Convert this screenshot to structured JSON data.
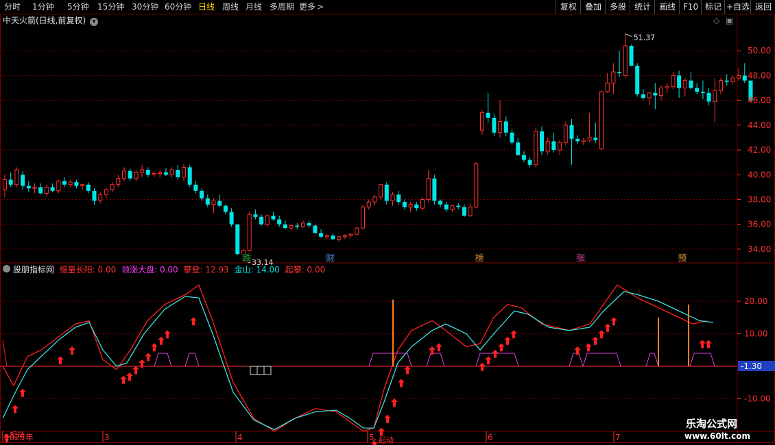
{
  "toolbar": {
    "periods": [
      "分时",
      "1分钟",
      "5分钟",
      "15分钟",
      "30分钟",
      "60分钟",
      "日线",
      "周线",
      "月线",
      "多周期",
      "更多"
    ],
    "active": "日线",
    "more_arrow": ">",
    "right_buttons": [
      "复权",
      "叠加",
      "多股",
      "统计",
      "画线",
      "F10",
      "+自选",
      "返回"
    ]
  },
  "main_panel": {
    "title": "中天火箭(日线,前复权)",
    "high_label": "51.37",
    "low_label": "33.14",
    "y_ticks": [
      "50.00",
      "48.00",
      "46.00",
      "44.00",
      "42.00",
      "40.00",
      "38.00",
      "36.00",
      "34.00"
    ],
    "markers": [
      {
        "text": "跌",
        "color": "#1aa01a"
      },
      {
        "text": "财",
        "color": "#3a7bd5"
      },
      {
        "text": "榜",
        "color": "#d68a1a"
      },
      {
        "text": "张",
        "color": "#d0308a"
      },
      {
        "text": "预",
        "color": "#d68a1a"
      }
    ]
  },
  "sub_panel": {
    "title": "股朋指标网",
    "items": [
      {
        "label": "缩量长阳:",
        "value": "0.00",
        "color": "#ff3030"
      },
      {
        "label": "领涨大盘:",
        "value": "0.00",
        "color": "#ff40ff"
      },
      {
        "label": "攀登:",
        "value": "12.93",
        "color": "#ff3030"
      },
      {
        "label": "金山:",
        "value": "14.00",
        "color": "#00e5e5"
      },
      {
        "label": "起攀:",
        "value": "0.00",
        "color": "#ff3030"
      }
    ],
    "y_ticks": [
      "20.00",
      "10.00",
      "-10.00"
    ],
    "current_value": "-1.30",
    "annotations": [
      "起动",
      "起动"
    ]
  },
  "x_axis": {
    "labels": [
      "2025年",
      "3",
      "4",
      "5",
      "6",
      "7"
    ]
  },
  "watermark": {
    "line1": "乐淘公式网",
    "line2": "www.60lt.com"
  },
  "colors": {
    "up": "#ff3030",
    "down": "#00e5e5",
    "grid": "#7a0000",
    "axis_text": "#ff3030"
  },
  "chart_data": {
    "type": "candlestick",
    "title": "中天火箭(日线,前复权)",
    "ylim": [
      33.0,
      52.0
    ],
    "ohlc": [
      [
        38.8,
        40.0,
        38.2,
        39.6
      ],
      [
        39.6,
        40.2,
        39.0,
        39.2
      ],
      [
        39.2,
        40.6,
        39.0,
        40.4
      ],
      [
        40.0,
        40.3,
        38.8,
        39.1
      ],
      [
        39.1,
        39.5,
        38.6,
        38.9
      ],
      [
        38.9,
        39.3,
        38.5,
        39.0
      ],
      [
        39.0,
        39.3,
        38.4,
        38.5
      ],
      [
        38.5,
        39.2,
        38.3,
        39.0
      ],
      [
        39.0,
        39.3,
        38.6,
        38.7
      ],
      [
        38.7,
        39.6,
        38.5,
        39.5
      ],
      [
        39.5,
        39.8,
        39.0,
        39.2
      ],
      [
        39.2,
        39.6,
        39.0,
        39.4
      ],
      [
        39.4,
        39.6,
        38.9,
        39.1
      ],
      [
        39.1,
        39.3,
        38.8,
        39.2
      ],
      [
        39.2,
        39.4,
        38.5,
        38.7
      ],
      [
        38.7,
        38.9,
        37.6,
        37.9
      ],
      [
        37.9,
        38.6,
        37.7,
        38.4
      ],
      [
        38.4,
        39.0,
        38.1,
        38.8
      ],
      [
        38.8,
        39.4,
        38.6,
        39.2
      ],
      [
        39.2,
        40.0,
        39.0,
        39.7
      ],
      [
        39.7,
        40.6,
        39.5,
        40.3
      ],
      [
        40.3,
        40.5,
        39.5,
        39.7
      ],
      [
        39.7,
        40.4,
        39.5,
        40.2
      ],
      [
        40.2,
        40.8,
        39.8,
        40.4
      ],
      [
        40.4,
        40.6,
        39.8,
        40.0
      ],
      [
        40.0,
        40.3,
        39.8,
        40.1
      ],
      [
        40.1,
        40.4,
        39.8,
        40.2
      ],
      [
        40.2,
        40.5,
        39.9,
        40.0
      ],
      [
        40.0,
        40.6,
        39.8,
        40.4
      ],
      [
        40.4,
        40.8,
        39.6,
        39.8
      ],
      [
        39.8,
        40.9,
        39.5,
        40.6
      ],
      [
        40.6,
        40.8,
        39.0,
        39.2
      ],
      [
        39.2,
        39.5,
        38.5,
        38.7
      ],
      [
        38.7,
        38.9,
        37.9,
        38.1
      ],
      [
        38.1,
        38.4,
        37.4,
        37.6
      ],
      [
        37.6,
        38.1,
        36.9,
        37.9
      ],
      [
        37.9,
        38.4,
        37.4,
        37.5
      ],
      [
        37.5,
        37.6,
        36.8,
        37.0
      ],
      [
        37.0,
        37.3,
        35.8,
        36.0
      ],
      [
        36.0,
        36.0,
        33.5,
        33.6
      ],
      [
        33.6,
        34.0,
        33.1,
        33.9
      ],
      [
        33.9,
        37.0,
        33.8,
        36.8
      ],
      [
        36.8,
        37.2,
        36.4,
        36.6
      ],
      [
        36.6,
        36.8,
        35.9,
        36.0
      ],
      [
        36.0,
        36.8,
        35.8,
        36.7
      ],
      [
        36.7,
        37.0,
        36.3,
        36.4
      ],
      [
        36.4,
        36.7,
        35.8,
        36.0
      ],
      [
        36.0,
        36.3,
        35.6,
        35.7
      ],
      [
        35.7,
        36.0,
        35.5,
        35.9
      ],
      [
        35.9,
        36.1,
        35.6,
        35.8
      ],
      [
        35.8,
        36.3,
        35.7,
        36.1
      ],
      [
        36.1,
        36.3,
        35.7,
        35.9
      ],
      [
        35.9,
        36.0,
        35.2,
        35.3
      ],
      [
        35.3,
        35.6,
        34.9,
        35.0
      ],
      [
        35.0,
        35.2,
        34.8,
        35.1
      ],
      [
        35.1,
        35.3,
        34.7,
        34.8
      ],
      [
        34.8,
        35.1,
        34.6,
        35.0
      ],
      [
        35.0,
        35.2,
        34.8,
        35.1
      ],
      [
        35.1,
        35.3,
        34.9,
        35.2
      ],
      [
        35.2,
        35.8,
        35.1,
        35.7
      ],
      [
        35.7,
        37.6,
        35.6,
        37.4
      ],
      [
        37.4,
        38.0,
        37.2,
        37.8
      ],
      [
        37.8,
        38.4,
        37.5,
        38.2
      ],
      [
        38.2,
        39.3,
        38.0,
        39.2
      ],
      [
        39.2,
        39.4,
        37.6,
        37.9
      ],
      [
        37.9,
        38.6,
        37.5,
        38.4
      ],
      [
        38.4,
        38.7,
        37.6,
        37.8
      ],
      [
        37.8,
        38.0,
        37.2,
        37.4
      ],
      [
        37.4,
        37.8,
        37.0,
        37.6
      ],
      [
        37.6,
        37.8,
        37.1,
        37.3
      ],
      [
        37.3,
        38.2,
        37.1,
        38.0
      ],
      [
        38.0,
        40.4,
        37.8,
        39.7
      ],
      [
        39.7,
        40.0,
        37.6,
        37.9
      ],
      [
        37.9,
        38.0,
        37.4,
        37.6
      ],
      [
        37.6,
        37.8,
        37.0,
        37.2
      ],
      [
        37.2,
        37.6,
        37.0,
        37.5
      ],
      [
        37.5,
        37.7,
        37.2,
        37.4
      ],
      [
        37.4,
        37.6,
        36.6,
        36.7
      ],
      [
        36.7,
        37.7,
        36.6,
        37.4
      ],
      [
        37.4,
        41.0,
        37.3,
        40.9
      ],
      [
        43.6,
        45.2,
        43.2,
        45.0
      ],
      [
        45.0,
        46.6,
        44.2,
        44.6
      ],
      [
        44.6,
        44.9,
        43.1,
        43.4
      ],
      [
        43.4,
        46.0,
        43.0,
        44.3
      ],
      [
        44.3,
        44.7,
        43.1,
        43.4
      ],
      [
        43.4,
        43.7,
        42.4,
        42.6
      ],
      [
        42.6,
        43.0,
        41.5,
        41.6
      ],
      [
        41.6,
        41.9,
        41.0,
        41.2
      ],
      [
        41.2,
        41.4,
        40.6,
        40.8
      ],
      [
        40.8,
        43.8,
        40.6,
        43.5
      ],
      [
        43.5,
        43.9,
        41.6,
        41.9
      ],
      [
        41.9,
        43.0,
        41.6,
        42.7
      ],
      [
        42.7,
        43.4,
        41.8,
        42.0
      ],
      [
        42.0,
        42.8,
        41.6,
        42.6
      ],
      [
        42.6,
        44.3,
        42.4,
        44.0
      ],
      [
        44.0,
        44.5,
        40.8,
        42.9
      ],
      [
        42.9,
        43.2,
        42.5,
        42.7
      ],
      [
        42.7,
        43.0,
        42.4,
        42.8
      ],
      [
        42.8,
        45.0,
        42.6,
        43.0
      ],
      [
        43.0,
        44.2,
        42.6,
        42.8
      ],
      [
        42.1,
        46.8,
        42.0,
        46.7
      ],
      [
        46.7,
        48.2,
        46.6,
        47.4
      ],
      [
        47.4,
        49.0,
        46.5,
        48.3
      ],
      [
        48.3,
        50.0,
        47.9,
        48.2
      ],
      [
        48.0,
        51.37,
        47.8,
        50.4
      ],
      [
        50.4,
        50.5,
        48.8,
        48.8
      ],
      [
        48.8,
        49.0,
        46.3,
        46.5
      ],
      [
        46.5,
        46.9,
        46.0,
        46.2
      ],
      [
        46.2,
        46.7,
        45.6,
        46.6
      ],
      [
        46.6,
        47.4,
        45.3,
        46.4
      ],
      [
        46.4,
        47.2,
        46.0,
        47.0
      ],
      [
        47.0,
        47.4,
        46.6,
        47.1
      ],
      [
        47.1,
        48.3,
        46.9,
        48.0
      ],
      [
        48.0,
        48.4,
        46.2,
        47.0
      ],
      [
        47.0,
        47.8,
        46.3,
        47.6
      ],
      [
        47.6,
        48.3,
        46.9,
        47.0
      ],
      [
        47.0,
        47.4,
        46.5,
        46.7
      ],
      [
        46.7,
        47.6,
        46.1,
        46.6
      ],
      [
        46.6,
        47.0,
        45.6,
        45.9
      ],
      [
        45.9,
        47.8,
        44.2,
        46.8
      ],
      [
        46.8,
        47.8,
        46.5,
        47.6
      ],
      [
        47.6,
        48.1,
        47.2,
        47.5
      ],
      [
        47.5,
        48.0,
        47.3,
        47.8
      ],
      [
        47.8,
        48.6,
        47.6,
        48.0
      ],
      [
        48.0,
        49.0,
        47.4,
        47.6
      ],
      [
        47.6,
        47.6,
        45.9,
        46.0
      ]
    ],
    "series": [
      {
        "name": "攀登",
        "values": []
      },
      {
        "name": "金山",
        "values": []
      }
    ],
    "y_ticks": [
      50,
      48,
      46,
      44,
      42,
      40,
      38,
      36,
      34
    ],
    "sub_ylim": [
      -20,
      28
    ]
  }
}
